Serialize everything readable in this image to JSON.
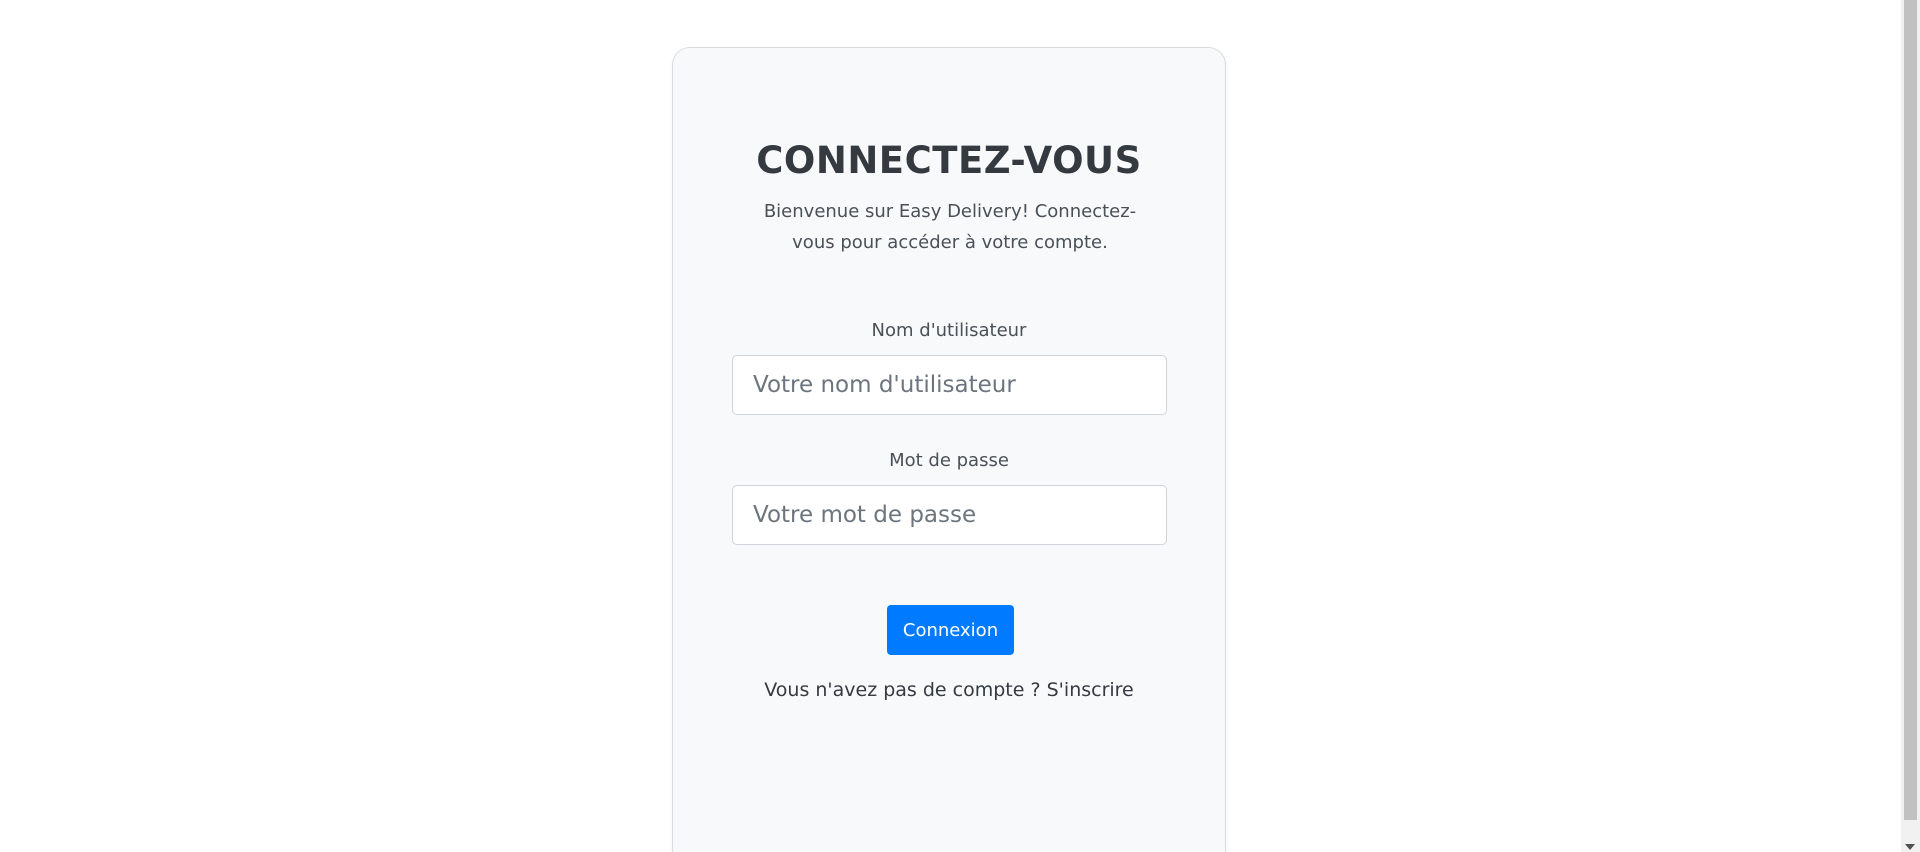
{
  "login": {
    "title": "CONNECTEZ-VOUS",
    "subtitle": "Bienvenue sur Easy Delivery! Connectez-vous pour accéder à votre compte.",
    "username_label": "Nom d'utilisateur",
    "username_placeholder": "Votre nom d'utilisateur",
    "username_value": "",
    "password_label": "Mot de passe",
    "password_placeholder": "Votre mot de passe",
    "password_value": "",
    "submit_label": "Connexion",
    "signup_prompt": "Vous n'avez pas de compte ?",
    "signup_link": "S'inscrire"
  },
  "colors": {
    "accent": "#007bff",
    "card_background": "#f8f9fa",
    "text_dark": "#343a40"
  },
  "icons": {
    "scroll_down": "chevron-down-icon"
  }
}
